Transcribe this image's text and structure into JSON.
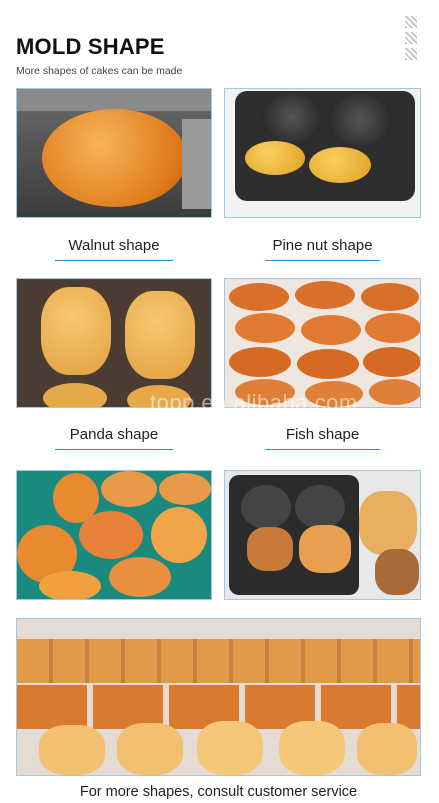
{
  "header": {
    "title": "MOLD SHAPE",
    "subtitle": "More shapes of cakes can be made"
  },
  "decor": {
    "stripe_icon": "striped-square-icon"
  },
  "products": [
    {
      "caption": "Walnut shape"
    },
    {
      "caption": "Pine nut shape"
    },
    {
      "caption": "Panda shape"
    },
    {
      "caption": "Fish shape"
    }
  ],
  "watermark": "topp.en.alibaba.com",
  "footer": {
    "text": "For more shapes, consult customer service"
  },
  "colors": {
    "accent_line": "#2c8fd0",
    "photo_border": "#9ecbe3",
    "cake_orange": "#e8892e",
    "cake_gold": "#e8b04a",
    "mold_dark": "#2b2b2b",
    "teal_bg": "#1a8a7e"
  }
}
